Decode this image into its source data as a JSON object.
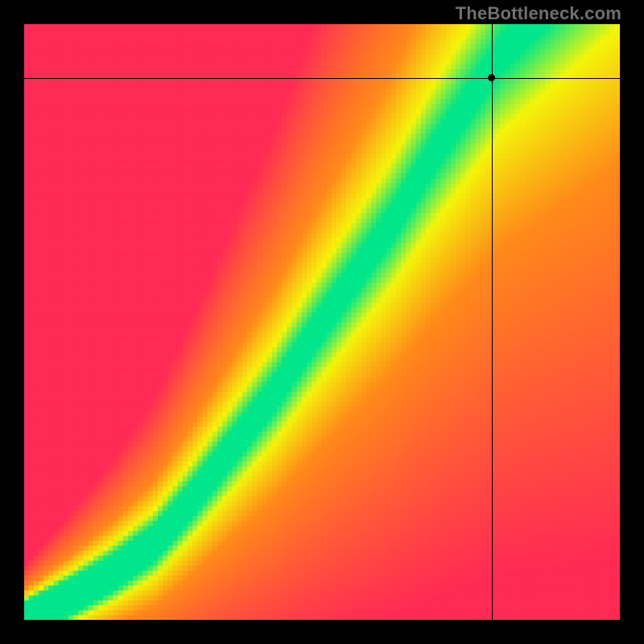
{
  "watermark": "TheBottleneck.com",
  "chart_data": {
    "type": "heatmap",
    "title": "",
    "xlabel": "",
    "ylabel": "",
    "xlim": [
      0,
      100
    ],
    "ylim": [
      0,
      100
    ],
    "ridge_points": [
      {
        "x": 0,
        "y": 0
      },
      {
        "x": 8,
        "y": 4
      },
      {
        "x": 15,
        "y": 8
      },
      {
        "x": 22,
        "y": 13
      },
      {
        "x": 28,
        "y": 20
      },
      {
        "x": 35,
        "y": 29
      },
      {
        "x": 42,
        "y": 38
      },
      {
        "x": 48,
        "y": 47
      },
      {
        "x": 55,
        "y": 57
      },
      {
        "x": 62,
        "y": 67
      },
      {
        "x": 68,
        "y": 77
      },
      {
        "x": 74,
        "y": 86
      },
      {
        "x": 80,
        "y": 95
      },
      {
        "x": 85,
        "y": 100
      }
    ],
    "band_half_width": 5.0,
    "colors": {
      "optimal": "#00e68a",
      "warn": "#f5f50a",
      "mid": "#ff8a1a",
      "bad": "#ff2a55"
    },
    "marker": {
      "x": 78.5,
      "y": 91
    },
    "crosshair": {
      "x": 78.5,
      "y": 91
    },
    "grid_resolution": 120
  }
}
